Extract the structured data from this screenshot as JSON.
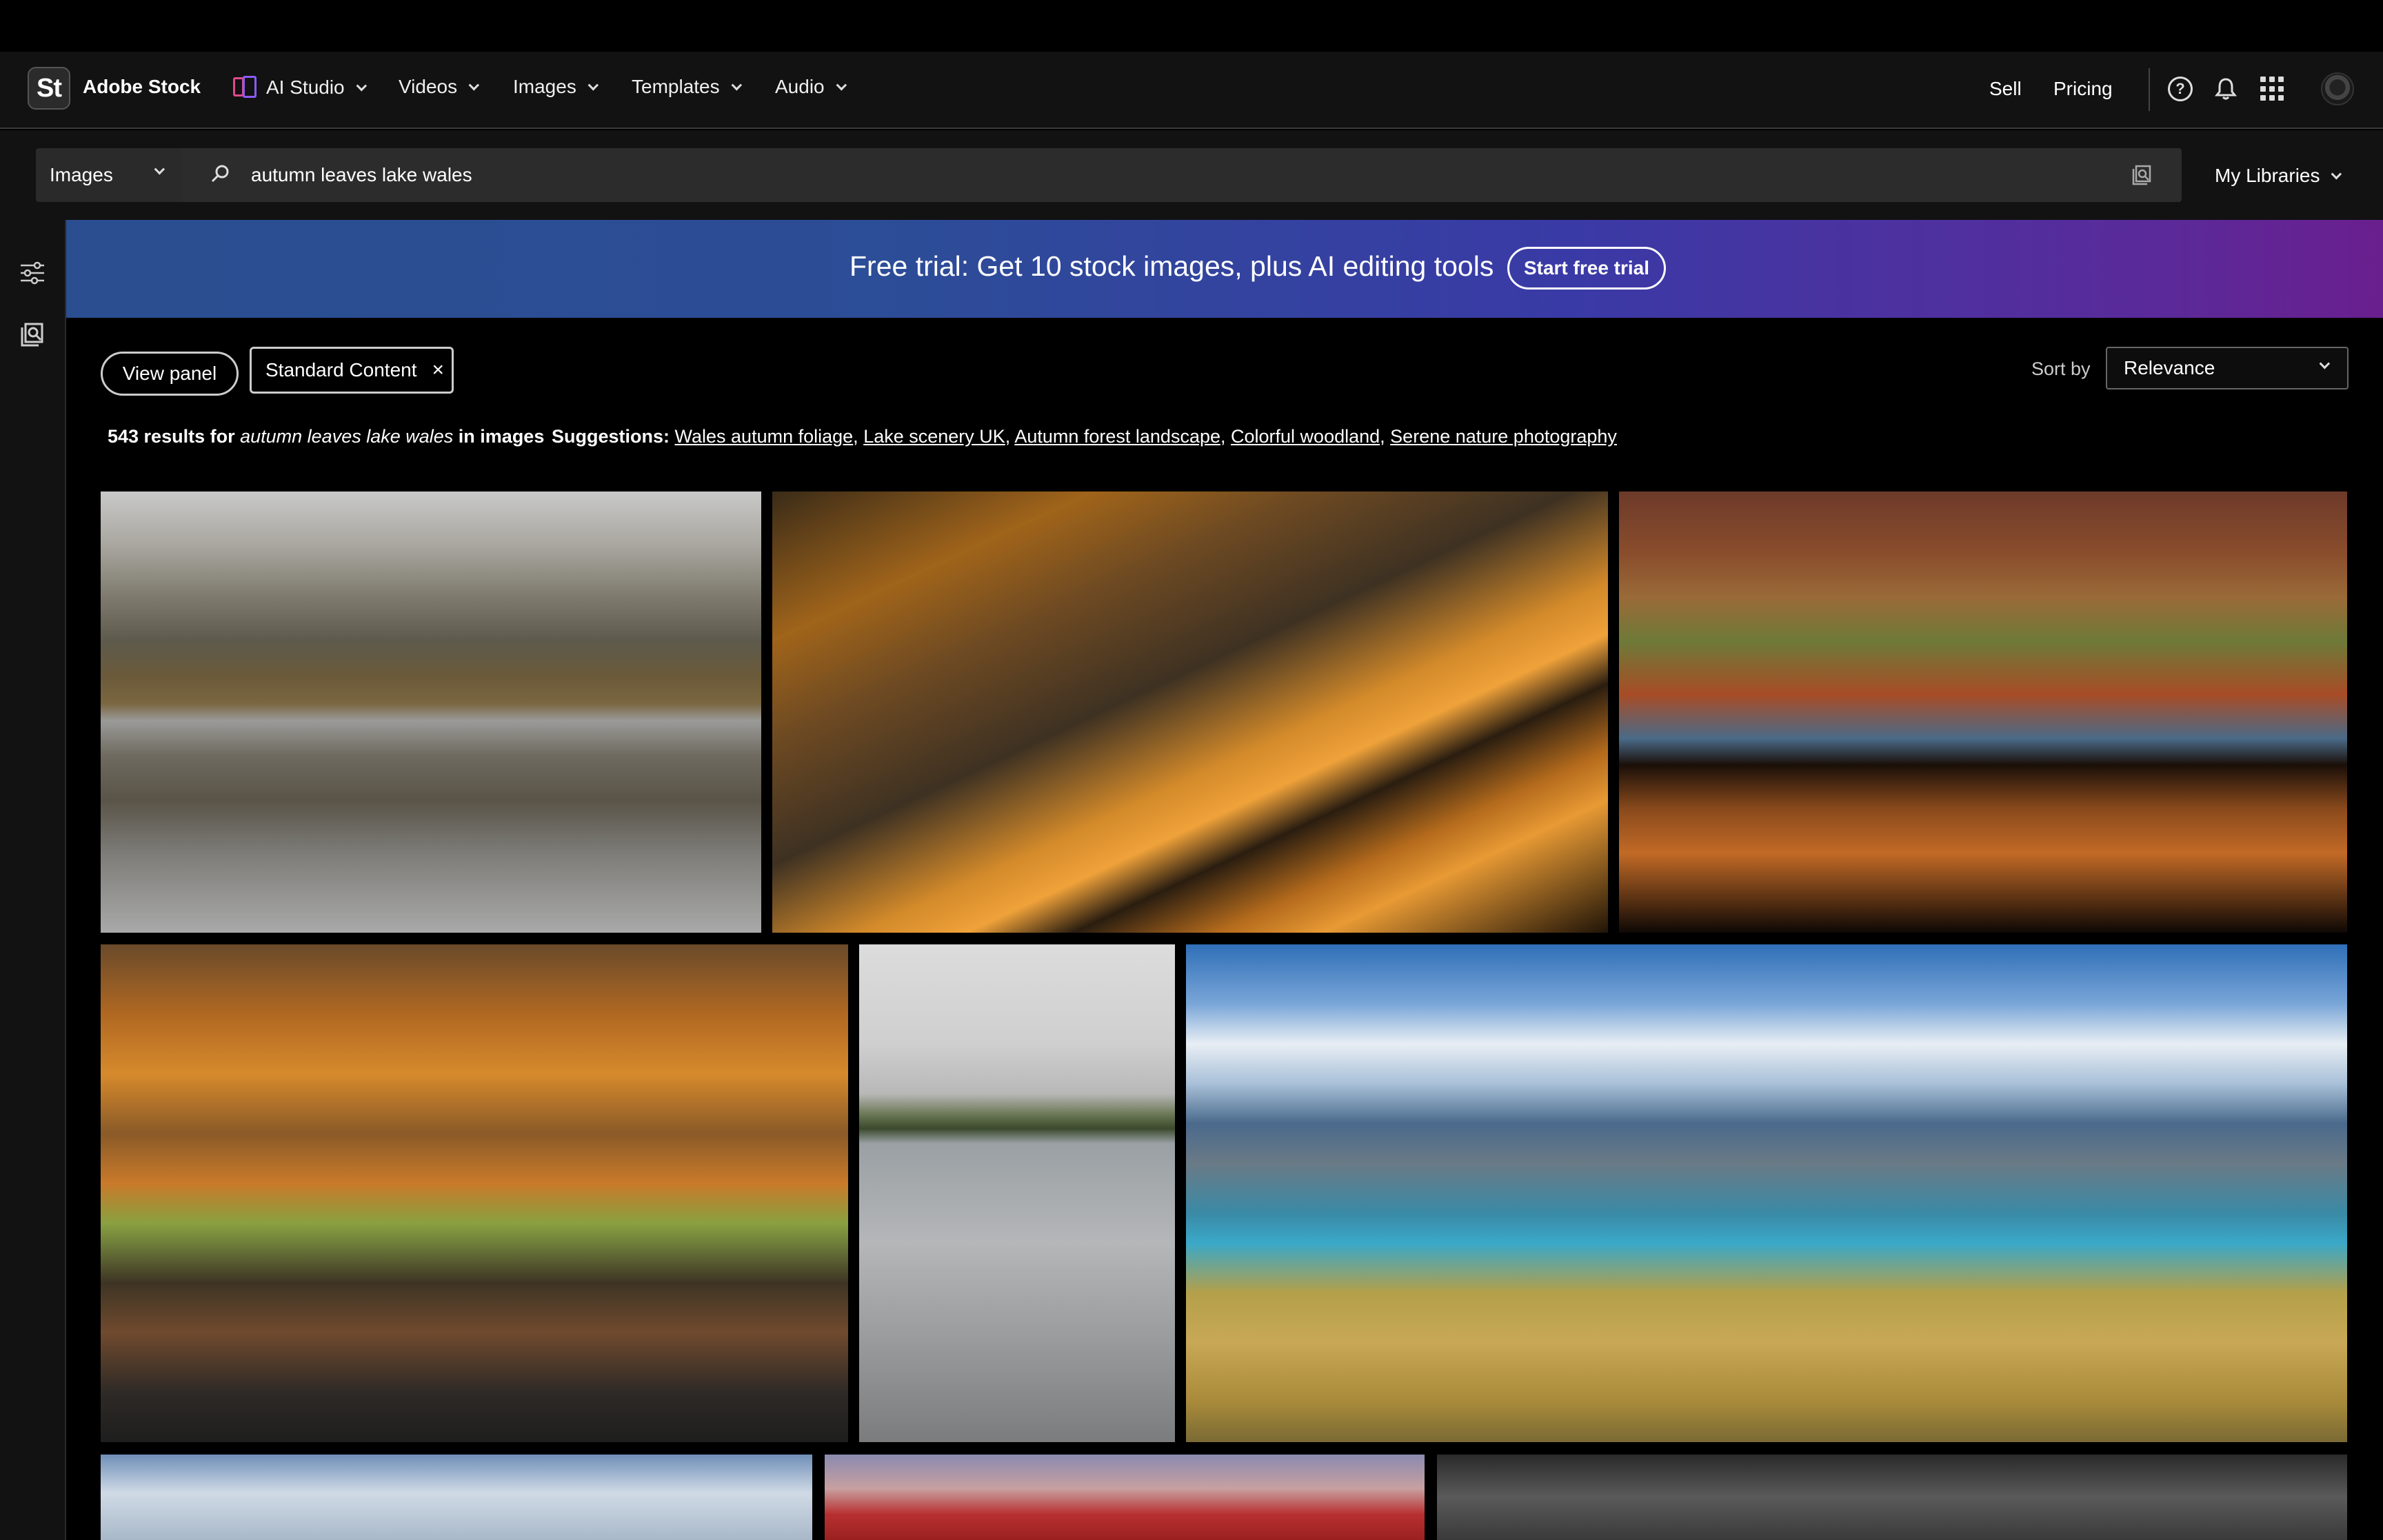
{
  "nav": {
    "logo": "St",
    "brand": "Adobe Stock",
    "items": [
      {
        "label": "AI Studio"
      },
      {
        "label": "Videos"
      },
      {
        "label": "Images"
      },
      {
        "label": "Templates"
      },
      {
        "label": "Audio"
      }
    ],
    "sell": "Sell",
    "pricing": "Pricing",
    "help": "?"
  },
  "search": {
    "scope": "Images",
    "query": "autumn leaves lake wales",
    "my_libraries": "My Libraries"
  },
  "banner": {
    "text": "Free trial: Get 10 stock images, plus AI editing tools",
    "button": "Start free trial"
  },
  "filters": {
    "view_panel": "View panel",
    "chip": "Standard Content",
    "chip_close": "×",
    "sort_label": "Sort by",
    "sort_value": "Relevance"
  },
  "results": {
    "count_text": "543 results for",
    "query": "autumn leaves lake wales",
    "scope_text": "in images",
    "suggestions_label": "Suggestions:",
    "suggestions": [
      "Wales autumn foliage",
      "Lake scenery UK",
      "Autumn forest landscape",
      "Colorful woodland",
      "Serene nature photography"
    ],
    "separator": ", "
  },
  "icons": {
    "help": "help-icon",
    "bell": "bell-icon",
    "apps": "apps-grid-icon",
    "filters": "filters-icon",
    "visual_search": "visual-search-icon"
  }
}
